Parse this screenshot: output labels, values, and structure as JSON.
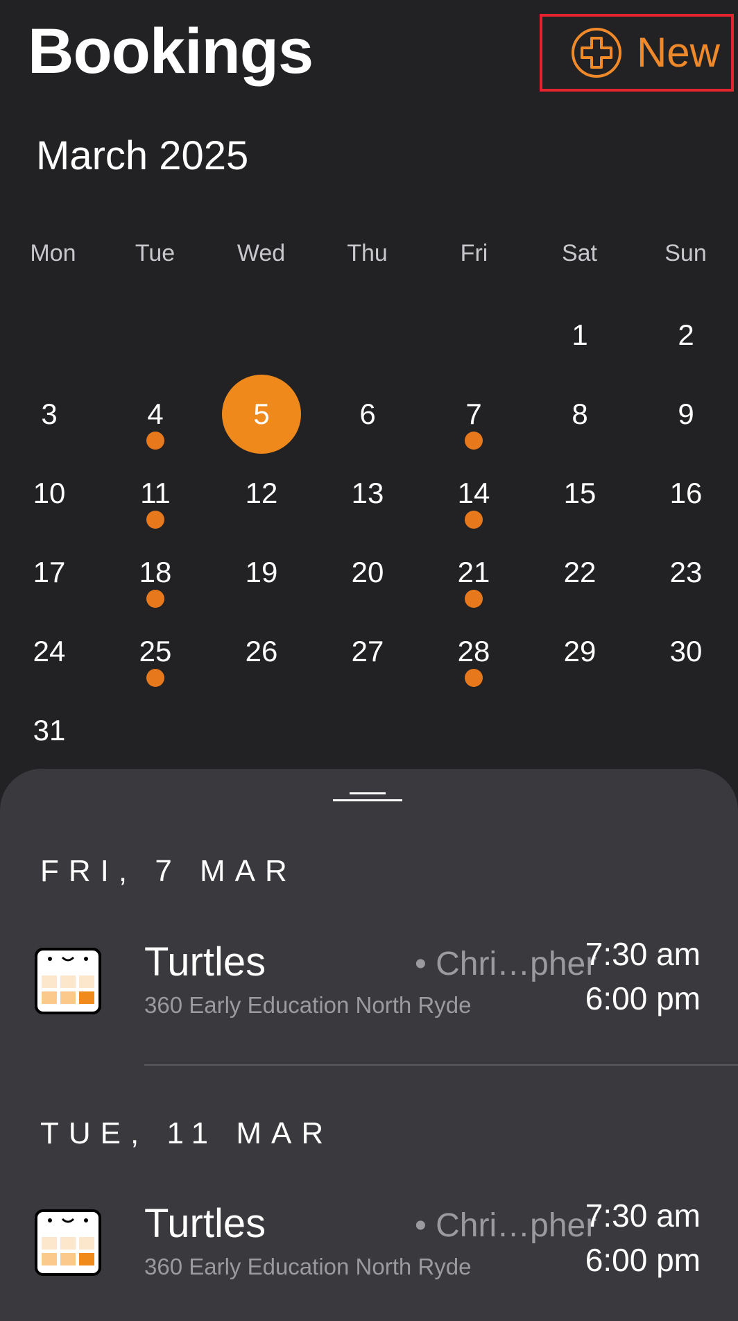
{
  "header": {
    "title": "Bookings",
    "new_button_label": "New",
    "new_button_icon": "plus-circle-icon",
    "accent_color": "#f0892a"
  },
  "calendar": {
    "month_label": "March 2025",
    "weekdays": [
      "Mon",
      "Tue",
      "Wed",
      "Thu",
      "Fri",
      "Sat",
      "Sun"
    ],
    "selected_day": "5",
    "booking_dot_days": [
      "4",
      "7",
      "11",
      "14",
      "18",
      "21",
      "25",
      "28"
    ],
    "weeks": [
      [
        "",
        "",
        "",
        "",
        "",
        "1",
        "2"
      ],
      [
        "3",
        "4",
        "5",
        "6",
        "7",
        "8",
        "9"
      ],
      [
        "10",
        "11",
        "12",
        "13",
        "14",
        "15",
        "16"
      ],
      [
        "17",
        "18",
        "19",
        "20",
        "21",
        "22",
        "23"
      ],
      [
        "24",
        "25",
        "26",
        "27",
        "28",
        "29",
        "30"
      ],
      [
        "31",
        "",
        "",
        "",
        "",
        "",
        ""
      ]
    ]
  },
  "bookings": [
    {
      "date_header": "FRI, 7 MAR",
      "room": "Turtles",
      "educator": "• Chri…pher",
      "location": "360 Early Education North Ryde",
      "start_time": "7:30 am",
      "end_time": "6:00 pm",
      "icon": "calendar-icon"
    },
    {
      "date_header": "TUE, 11 MAR",
      "room": "Turtles",
      "educator": "• Chri…pher",
      "location": "360 Early Education North Ryde",
      "start_time": "7:30 am",
      "end_time": "6:00 pm",
      "icon": "calendar-icon"
    }
  ]
}
